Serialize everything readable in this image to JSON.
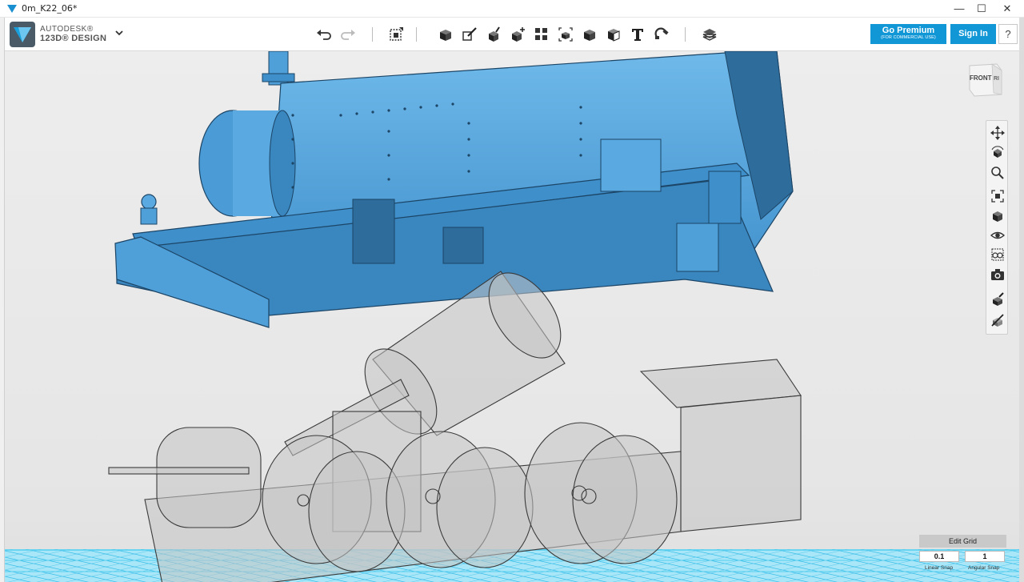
{
  "window": {
    "title": "0m_K22_06*",
    "controls": {
      "minimize": "—",
      "maximize": "☐",
      "close": "✕"
    }
  },
  "brand": {
    "line1": "AUTODESK®",
    "line2": "123D® DESIGN"
  },
  "toolbar": {
    "tools": [
      "undo-icon",
      "redo-icon",
      "transform-icon",
      "primitives-icon",
      "sketch-icon",
      "construct-icon",
      "modify-icon",
      "pattern-icon",
      "grouping-icon",
      "combine-icon",
      "measure-icon",
      "text-icon",
      "snap-icon",
      "material-icon"
    ],
    "premium_label": "Go Premium",
    "premium_sub": "(FOR COMMERCIAL USE)",
    "signin_label": "Sign In",
    "help_label": "?"
  },
  "viewcube": {
    "face_label": "FRONT",
    "side_label": "RI"
  },
  "navbar": {
    "tools": [
      "pan-icon",
      "orbit-icon",
      "zoom-icon",
      "fit-icon",
      "view-icon",
      "visibility-icon",
      "material-view-icon",
      "camera-icon",
      "snap-grid-icon",
      "hide-icon"
    ]
  },
  "grid": {
    "title": "Edit Grid",
    "linear_value": "0.1",
    "angular_value": "1",
    "linear_label": "Linear Snap",
    "angular_label": "Angular Snap"
  },
  "colors": {
    "accent": "#1196d6",
    "model_blue": "#5aa9e0",
    "model_dark": "#2d5f86",
    "ghost": "#b9b9b9",
    "floor_cyan": "#6fd3f0"
  }
}
